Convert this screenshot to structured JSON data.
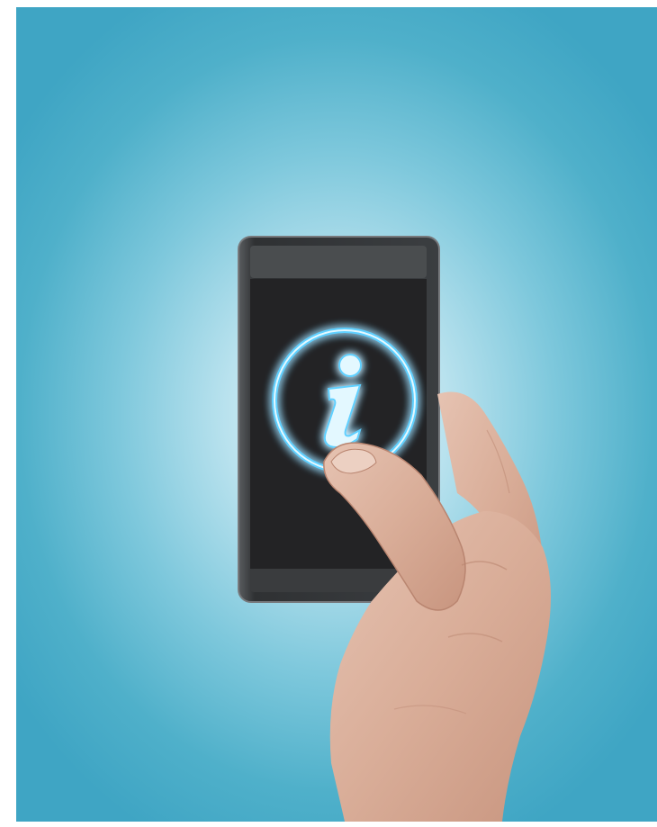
{
  "scene": {
    "subject": "hand-holding-smartphone",
    "screen_icon": "info-icon",
    "colors": {
      "background_center": "#e9f7fb",
      "background_edge": "#3fa5c4",
      "phone_body": "#2f3133",
      "screen": "#242426",
      "screen_top_bar": "#4a4d4f",
      "icon_glow": "#5fd0ff",
      "icon_core": "#dff6ff",
      "skin": "#d9b4a2"
    }
  }
}
